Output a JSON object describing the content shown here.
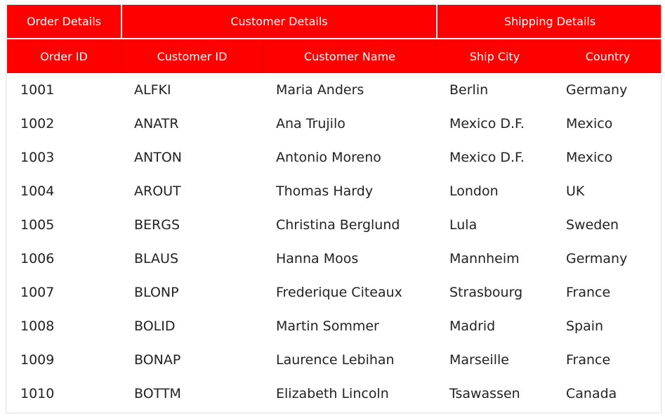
{
  "header_groups": [
    {
      "label": "Order Details"
    },
    {
      "label": "Customer Details"
    },
    {
      "label": "Shipping Details"
    }
  ],
  "columns": [
    {
      "label": "Order ID"
    },
    {
      "label": "Customer ID"
    },
    {
      "label": "Customer Name"
    },
    {
      "label": "Ship City"
    },
    {
      "label": "Country"
    }
  ],
  "colors": {
    "header_bg": "#ff0000",
    "header_text": "#ffffff"
  },
  "rows": [
    [
      "1001",
      "ALFKI",
      "Maria Anders",
      "Berlin",
      "Germany"
    ],
    [
      "1002",
      "ANATR",
      "Ana Trujilo",
      "Mexico D.F.",
      "Mexico"
    ],
    [
      "1003",
      "ANTON",
      "Antonio Moreno",
      "Mexico D.F.",
      "Mexico"
    ],
    [
      "1004",
      "AROUT",
      "Thomas Hardy",
      "London",
      "UK"
    ],
    [
      "1005",
      "BERGS",
      "Christina Berglund",
      "Lula",
      "Sweden"
    ],
    [
      "1006",
      "BLAUS",
      "Hanna Moos",
      "Mannheim",
      "Germany"
    ],
    [
      "1007",
      "BLONP",
      "Frederique Citeaux",
      "Strasbourg",
      "France"
    ],
    [
      "1008",
      "BOLID",
      "Martin Sommer",
      "Madrid",
      "Spain"
    ],
    [
      "1009",
      "BONAP",
      "Laurence Lebihan",
      "Marseille",
      "France"
    ],
    [
      "1010",
      "BOTTM",
      "Elizabeth Lincoln",
      "Tsawassen",
      "Canada"
    ]
  ]
}
